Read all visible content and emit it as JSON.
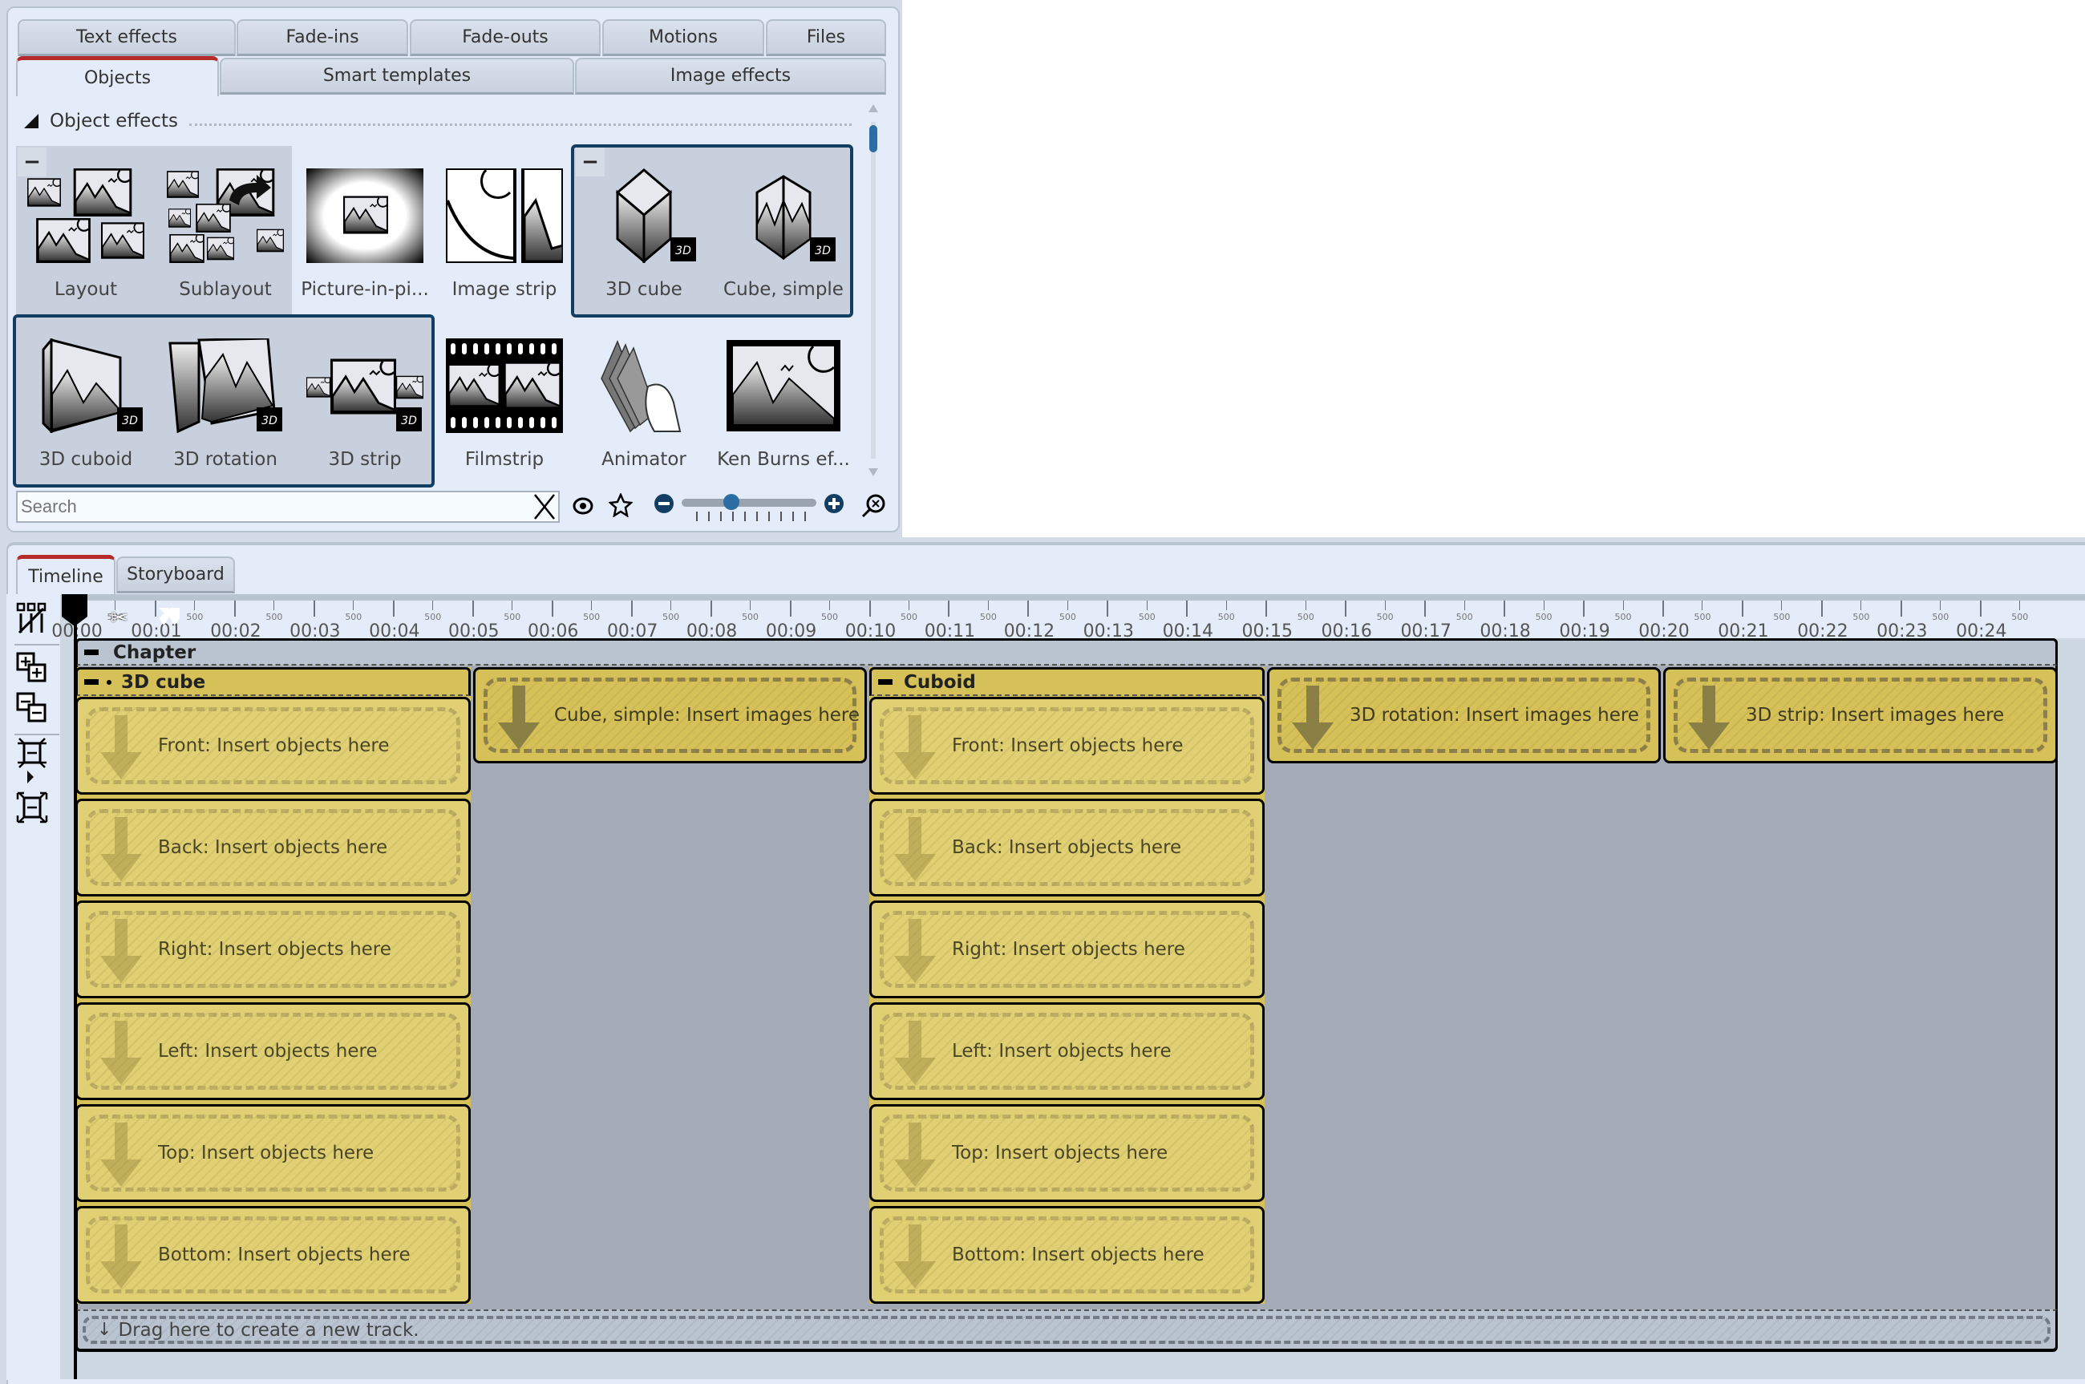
{
  "effects_panel": {
    "tabs_row1": [
      {
        "label": "Text effects",
        "active": false
      },
      {
        "label": "Fade-ins",
        "active": false
      },
      {
        "label": "Fade-outs",
        "active": false
      },
      {
        "label": "Motions",
        "active": false
      },
      {
        "label": "Files",
        "active": false
      }
    ],
    "tabs_row2": [
      {
        "label": "Objects",
        "active": true
      },
      {
        "label": "Smart templates",
        "active": false
      },
      {
        "label": "Image effects",
        "active": false
      }
    ],
    "section_title": "Object effects",
    "tiles": [
      {
        "label": "Layout",
        "icon": "layout-icon",
        "badge": ""
      },
      {
        "label": "Sublayout",
        "icon": "sublayout-icon",
        "badge": ""
      },
      {
        "label": "Picture-in-pi...",
        "icon": "picture-in-picture-icon",
        "badge": ""
      },
      {
        "label": "Image strip",
        "icon": "image-strip-icon",
        "badge": ""
      },
      {
        "label": "3D cube",
        "icon": "cube-icon",
        "badge": "3D"
      },
      {
        "label": "Cube, simple",
        "icon": "cube-simple-icon",
        "badge": "3D"
      },
      {
        "label": "3D cuboid",
        "icon": "cuboid-icon",
        "badge": "3D"
      },
      {
        "label": "3D rotation",
        "icon": "rotation-icon",
        "badge": "3D"
      },
      {
        "label": "3D strip",
        "icon": "strip-3d-icon",
        "badge": "3D"
      },
      {
        "label": "Filmstrip",
        "icon": "filmstrip-icon",
        "badge": ""
      },
      {
        "label": "Animator",
        "icon": "animator-icon",
        "badge": ""
      },
      {
        "label": "Ken Burns ef...",
        "icon": "ken-burns-icon",
        "badge": ""
      }
    ],
    "group_collapse_symbol": "−",
    "search": {
      "placeholder": "Search",
      "value": ""
    },
    "zoom_slider": {
      "value_fraction": 0.35
    }
  },
  "timeline_panel": {
    "tabs": [
      {
        "label": "Timeline",
        "active": true
      },
      {
        "label": "Storyboard",
        "active": false
      }
    ],
    "ruler": {
      "labels": [
        "00:00",
        "00:01",
        "00:02",
        "00:03",
        "00:04",
        "00:05",
        "00:06",
        "00:07",
        "00:08",
        "00:09",
        "00:10",
        "00:11",
        "00:12",
        "00:13",
        "00:14",
        "00:15",
        "00:16",
        "00:17",
        "00:18",
        "00:19",
        "00:20",
        "00:21",
        "00:22",
        "00:23",
        "00:24"
      ],
      "sub_label": "500"
    },
    "chapter": {
      "title": "Chapter"
    },
    "blocks": {
      "cube": {
        "title": "3D cube",
        "slots": [
          "Front: Insert objects here",
          "Back: Insert objects here",
          "Right: Insert objects here",
          "Left: Insert objects here",
          "Top: Insert objects here",
          "Bottom: Insert objects here"
        ]
      },
      "cube_simple": {
        "text": "Cube, simple: Insert images here"
      },
      "cuboid": {
        "title": "Cuboid",
        "slots": [
          "Front: Insert objects here",
          "Back: Insert objects here",
          "Right: Insert objects here",
          "Left: Insert objects here",
          "Top: Insert objects here",
          "Bottom: Insert objects here"
        ]
      },
      "rotation": {
        "text": "3D rotation: Insert images here"
      },
      "strip": {
        "text": "3D strip: Insert images here"
      }
    },
    "drag_track": "Drag here to create a new track."
  },
  "colors": {
    "accent_active_tab": "#b52a2a",
    "selection_border": "#133e63",
    "object_block": "#d5c157",
    "slider_knob": "#2c6ea4"
  }
}
